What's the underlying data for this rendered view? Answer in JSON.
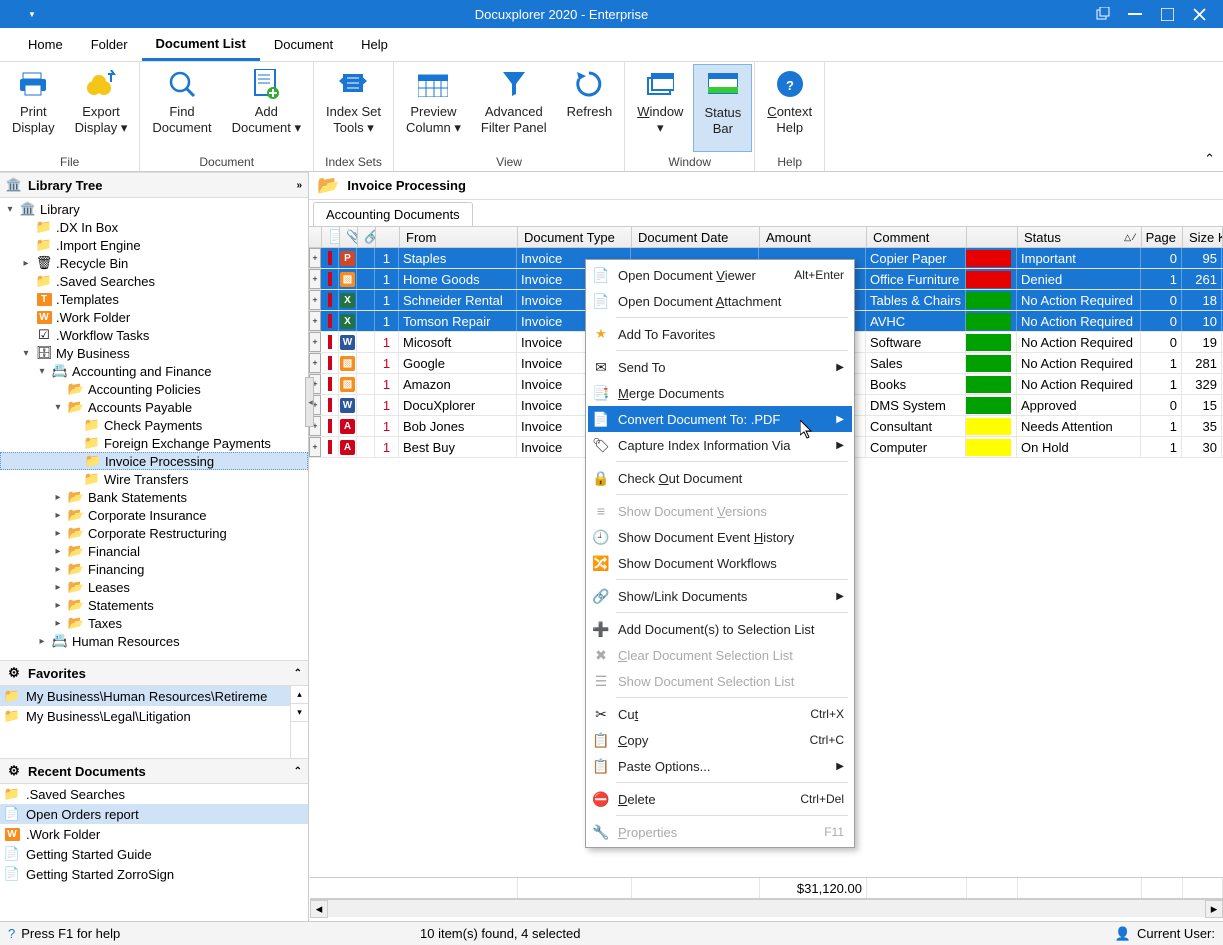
{
  "title": "Docuxplorer 2020 - Enterprise",
  "menu_tabs": [
    "Home",
    "Folder",
    "Document List",
    "Document",
    "Help"
  ],
  "menu_active": "Document List",
  "ribbon": {
    "groups": [
      {
        "label": "File",
        "buttons": [
          {
            "lbl": "Print\nDisplay",
            "icon": "printer"
          },
          {
            "lbl": "Export\nDisplay ▾",
            "icon": "export"
          }
        ]
      },
      {
        "label": "Document",
        "buttons": [
          {
            "lbl": "Find\nDocument",
            "icon": "search"
          },
          {
            "lbl": "Add\nDocument ▾",
            "icon": "add-doc"
          }
        ]
      },
      {
        "label": "Index Sets",
        "buttons": [
          {
            "lbl": "Index Set\nTools ▾",
            "icon": "tags"
          }
        ]
      },
      {
        "label": "View",
        "buttons": [
          {
            "lbl": "Preview\nColumn ▾",
            "icon": "calendar"
          },
          {
            "lbl": "Advanced\nFilter Panel",
            "icon": "funnel"
          },
          {
            "lbl": "Refresh",
            "icon": "refresh"
          }
        ]
      },
      {
        "label": "Window",
        "buttons": [
          {
            "lbl": "Window\n▾",
            "icon": "windows",
            "und": "W"
          },
          {
            "lbl": "Status\nBar",
            "icon": "status-bar",
            "pressed": true
          }
        ]
      },
      {
        "label": "Help",
        "buttons": [
          {
            "lbl": "Context\nHelp",
            "icon": "help",
            "und": "H"
          }
        ]
      }
    ]
  },
  "left": {
    "tree_title": "Library Tree",
    "favorites_title": "Favorites",
    "recent_title": "Recent Documents",
    "tree": [
      {
        "d": 0,
        "tw": "▾",
        "ic": "library",
        "t": "Library"
      },
      {
        "d": 1,
        "tw": "",
        "ic": "folder-y",
        "t": ".DX In Box"
      },
      {
        "d": 1,
        "tw": "",
        "ic": "folder-y",
        "t": ".Import Engine"
      },
      {
        "d": 1,
        "tw": "▸",
        "ic": "recycle",
        "t": ".Recycle Bin"
      },
      {
        "d": 1,
        "tw": "",
        "ic": "folder-y",
        "t": ".Saved Searches"
      },
      {
        "d": 1,
        "tw": "",
        "ic": "folder-t",
        "t": ".Templates"
      },
      {
        "d": 1,
        "tw": "",
        "ic": "folder-w",
        "t": ".Work Folder"
      },
      {
        "d": 1,
        "tw": "",
        "ic": "check",
        "t": ".Workflow Tasks"
      },
      {
        "d": 1,
        "tw": "▾",
        "ic": "cabinet",
        "t": "My Business"
      },
      {
        "d": 2,
        "tw": "▾",
        "ic": "drawer",
        "t": "Accounting and Finance"
      },
      {
        "d": 3,
        "tw": "",
        "ic": "folder-o",
        "t": "Accounting Policies"
      },
      {
        "d": 3,
        "tw": "▾",
        "ic": "folder-o",
        "t": "Accounts Payable"
      },
      {
        "d": 4,
        "tw": "",
        "ic": "folder-y",
        "t": "Check Payments"
      },
      {
        "d": 4,
        "tw": "",
        "ic": "folder-y",
        "t": "Foreign Exchange Payments"
      },
      {
        "d": 4,
        "tw": "",
        "ic": "folder-y",
        "t": "Invoice Processing",
        "sel": true
      },
      {
        "d": 4,
        "tw": "",
        "ic": "folder-y",
        "t": "Wire Transfers"
      },
      {
        "d": 3,
        "tw": "▸",
        "ic": "folder-o",
        "t": "Bank Statements"
      },
      {
        "d": 3,
        "tw": "▸",
        "ic": "folder-o",
        "t": "Corporate Insurance"
      },
      {
        "d": 3,
        "tw": "▸",
        "ic": "folder-o",
        "t": "Corporate Restructuring"
      },
      {
        "d": 3,
        "tw": "▸",
        "ic": "folder-o",
        "t": "Financial"
      },
      {
        "d": 3,
        "tw": "▸",
        "ic": "folder-o",
        "t": "Financing"
      },
      {
        "d": 3,
        "tw": "▸",
        "ic": "folder-o",
        "t": "Leases"
      },
      {
        "d": 3,
        "tw": "▸",
        "ic": "folder-o",
        "t": "Statements"
      },
      {
        "d": 3,
        "tw": "▸",
        "ic": "folder-o",
        "t": "Taxes"
      },
      {
        "d": 2,
        "tw": "▸",
        "ic": "drawer",
        "t": "Human Resources"
      }
    ],
    "favorites": [
      {
        "t": "My Business\\Human Resources\\Retireme"
      },
      {
        "t": "My Business\\Legal\\Litigation"
      }
    ],
    "recent": [
      {
        "ic": "folder-y",
        "t": ".Saved Searches"
      },
      {
        "ic": "doc",
        "t": "Open Orders report",
        "sel": true
      },
      {
        "ic": "folder-w",
        "t": ".Work Folder"
      },
      {
        "ic": "doc",
        "t": "Getting Started Guide"
      },
      {
        "ic": "doc",
        "t": "Getting Started ZorroSign"
      }
    ]
  },
  "grid": {
    "location": "Invoice Processing",
    "indexset": "Accounting Documents",
    "columns": [
      "From",
      "Document Type",
      "Document Date",
      "Amount",
      "Comment",
      "Status",
      "Page",
      "Size Kb"
    ],
    "rows": [
      {
        "sel": true,
        "ic": "ppt",
        "n": "1",
        "from": "Staples",
        "type": "Invoice",
        "date": "",
        "amt": "",
        "com": "Copier Paper",
        "sw": "#e60000",
        "stat": "Important",
        "pg": "0",
        "sz": "95"
      },
      {
        "sel": true,
        "ic": "img",
        "n": "1",
        "from": "Home Goods",
        "type": "Invoice",
        "date": "",
        "amt": "",
        "com": "Office Furniture",
        "sw": "#e60000",
        "stat": "Denied",
        "pg": "1",
        "sz": "261"
      },
      {
        "sel": true,
        "ic": "xls",
        "n": "1",
        "from": "Schneider Rental",
        "type": "Invoice",
        "date": "",
        "amt": "",
        "com": "Tables & Chairs",
        "sw": "#00a000",
        "stat": "No Action Required",
        "pg": "0",
        "sz": "18"
      },
      {
        "sel": true,
        "ic": "xls",
        "n": "1",
        "from": "Tomson Repair",
        "type": "Invoice",
        "date": "",
        "amt": "",
        "com": "AVHC",
        "sw": "#00a000",
        "stat": "No Action Required",
        "pg": "0",
        "sz": "10"
      },
      {
        "sel": false,
        "ic": "doc",
        "n": "1",
        "from": "Micosoft",
        "type": "Invoice",
        "date": "",
        "amt": "",
        "com": "Software",
        "sw": "#00a000",
        "stat": "No Action Required",
        "pg": "0",
        "sz": "19"
      },
      {
        "sel": false,
        "ic": "img",
        "n": "1",
        "from": "Google",
        "type": "Invoice",
        "date": "",
        "amt": "",
        "com": "Sales",
        "sw": "#00a000",
        "stat": "No Action Required",
        "pg": "1",
        "sz": "281"
      },
      {
        "sel": false,
        "ic": "img",
        "n": "1",
        "from": "Amazon",
        "type": "Invoice",
        "date": "",
        "amt": "",
        "com": "Books",
        "sw": "#00a000",
        "stat": "No Action Required",
        "pg": "1",
        "sz": "329"
      },
      {
        "sel": false,
        "ic": "doc",
        "n": "1",
        "from": "DocuXplorer",
        "type": "Invoice",
        "date": "",
        "amt": "",
        "com": "DMS System",
        "sw": "#00a000",
        "stat": "Approved",
        "pg": "0",
        "sz": "15"
      },
      {
        "sel": false,
        "ic": "pdf",
        "n": "1",
        "from": "Bob Jones",
        "type": "Invoice",
        "date": "",
        "amt": "",
        "com": "Consultant",
        "sw": "#ffff00",
        "stat": "Needs Attention",
        "pg": "1",
        "sz": "35"
      },
      {
        "sel": false,
        "ic": "pdf",
        "n": "1",
        "from": "Best Buy",
        "type": "Invoice",
        "date": "",
        "amt": "",
        "com": "Computer",
        "sw": "#ffff00",
        "stat": "On Hold",
        "pg": "1",
        "sz": "30"
      }
    ],
    "sum": "$31,120.00"
  },
  "ctx": [
    {
      "t": "Open Document Viewer",
      "ic": "doc",
      "sc": "Alt+Enter",
      "u": "V"
    },
    {
      "t": "Open Document Attachment",
      "ic": "doc",
      "u": "A"
    },
    {
      "sep": true
    },
    {
      "t": "Add To Favorites",
      "ic": "star"
    },
    {
      "sep": true
    },
    {
      "t": "Send To",
      "ic": "send",
      "sub": true
    },
    {
      "t": "Merge Documents",
      "ic": "merge",
      "u": "M"
    },
    {
      "t": "Convert Document To: .PDF",
      "ic": "convert",
      "hl": true,
      "sub": true
    },
    {
      "t": "Capture Index Information Via",
      "ic": "tags",
      "sub": true
    },
    {
      "sep": true
    },
    {
      "t": "Check Out Document",
      "ic": "lock",
      "u": "O"
    },
    {
      "sep": true
    },
    {
      "t": "Show Document Versions",
      "ic": "versions",
      "dis": true,
      "u": "V"
    },
    {
      "t": "Show Document Event History",
      "ic": "history",
      "u": "H"
    },
    {
      "t": "Show Document Workflows",
      "ic": "workflow"
    },
    {
      "sep": true
    },
    {
      "t": "Show/Link Documents",
      "ic": "link",
      "sub": true
    },
    {
      "sep": true
    },
    {
      "t": "Add Document(s) to Selection List",
      "ic": "add-list"
    },
    {
      "t": "Clear Document Selection List",
      "ic": "clear",
      "dis": true,
      "u": "C"
    },
    {
      "t": "Show Document Selection List",
      "ic": "show",
      "dis": true
    },
    {
      "sep": true
    },
    {
      "t": "Cut",
      "ic": "cut",
      "sc": "Ctrl+X",
      "u": "t"
    },
    {
      "t": "Copy",
      "ic": "copy",
      "sc": "Ctrl+C",
      "u": "C"
    },
    {
      "t": "Paste Options...",
      "ic": "paste",
      "sub": true
    },
    {
      "sep": true
    },
    {
      "t": "Delete",
      "ic": "delete",
      "sc": "Ctrl+Del",
      "u": "D"
    },
    {
      "sep": true
    },
    {
      "t": "Properties",
      "ic": "props",
      "sc": "F11",
      "dis": true,
      "u": "P"
    }
  ],
  "status": {
    "help": "Press F1 for help",
    "mid": "10 item(s) found, 4 selected",
    "right": "Current User:"
  },
  "icon_map": {
    "printer": "🖨️",
    "export": "💰",
    "search": "🔍",
    "add-doc": "📄",
    "tags": "◈",
    "calendar": "▦",
    "funnel": "▼",
    "refresh": "↻",
    "windows": "▭",
    "status-bar": "▬",
    "help": "?",
    "library": "🏛️",
    "folder-y": "📁",
    "recycle": "🗑",
    "folder-t": "T",
    "folder-w": "W",
    "check": "☑",
    "cabinet": "🗄",
    "drawer": "🗂",
    "folder-o": "📂",
    "ppt": "P",
    "img": "🖼",
    "xls": "X",
    "doc": "W",
    "pdf": "A",
    "send": "✉",
    "merge": "⧉",
    "convert": "📄",
    "lock": "🔒",
    "versions": "≡",
    "history": "🕘",
    "workflow": "⚙",
    "link": "🔗",
    "add-list": "+",
    "clear": "✕",
    "show": "☰",
    "cut": "✂",
    "copy": "⧉",
    "paste": "📋",
    "delete": "⛔",
    "props": "🔧",
    "star": "★"
  }
}
